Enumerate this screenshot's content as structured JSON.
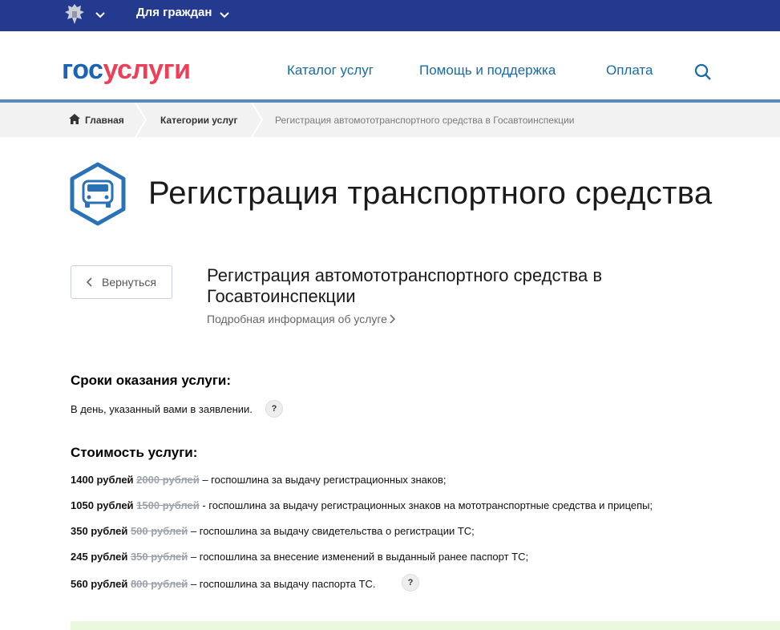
{
  "topbar": {
    "label": "Для граждан",
    "emblem_icon": "coat-of-arms-icon",
    "chevron_icon": "chevron-down-icon",
    "background": "#233a8f"
  },
  "header": {
    "logo_part1": "гос",
    "logo_part2": "услуги",
    "nav": [
      "Каталог услуг",
      "Помощь и поддержка",
      "Оплата"
    ],
    "search_icon": "search-icon",
    "brand_blue": "#1b63b8",
    "brand_red": "#ee3f58"
  },
  "breadcrumb": {
    "items": [
      "Главная",
      "Категории услуг",
      "Регистрация автомототранспортного средства в Госавтоинспекции"
    ]
  },
  "page": {
    "title": "Регистрация транспортного средства",
    "badge_icon": "car-icon"
  },
  "service": {
    "back_label": "Вернуться",
    "title": "Регистрация автомототранспортного средства в Госавтоинспекции",
    "details_link": "Подробная информация об услуге"
  },
  "terms": {
    "heading": "Сроки оказания услуги:",
    "text": "В день, указанный вами в заявлении.",
    "help": "?"
  },
  "cost": {
    "heading": "Стоимость услуги:",
    "help": "?",
    "items": [
      {
        "amount": "1400 рублей",
        "old": "2000 рублей",
        "desc": " – госпошлина за выдачу регистрационных знаков;"
      },
      {
        "amount": "1050 рублей",
        "old": "1500 рублей",
        "desc": " - госпошлина за выдачу регистрационных знаков на мототранспортные средства и прицепы;"
      },
      {
        "amount": "350 рублей",
        "old": "500 рублей",
        "desc": " – госпошлина за выдачу свидетельства о регистрации ТС;"
      },
      {
        "amount": "245 рублей",
        "old": "350 рублей",
        "desc": " – госпошлина за внесение изменений в выданный ранее паспорт ТС;"
      },
      {
        "amount": "560 рублей",
        "old": "800 рублей",
        "desc": " – госпошлина за выдачу паспорта ТС."
      }
    ]
  }
}
